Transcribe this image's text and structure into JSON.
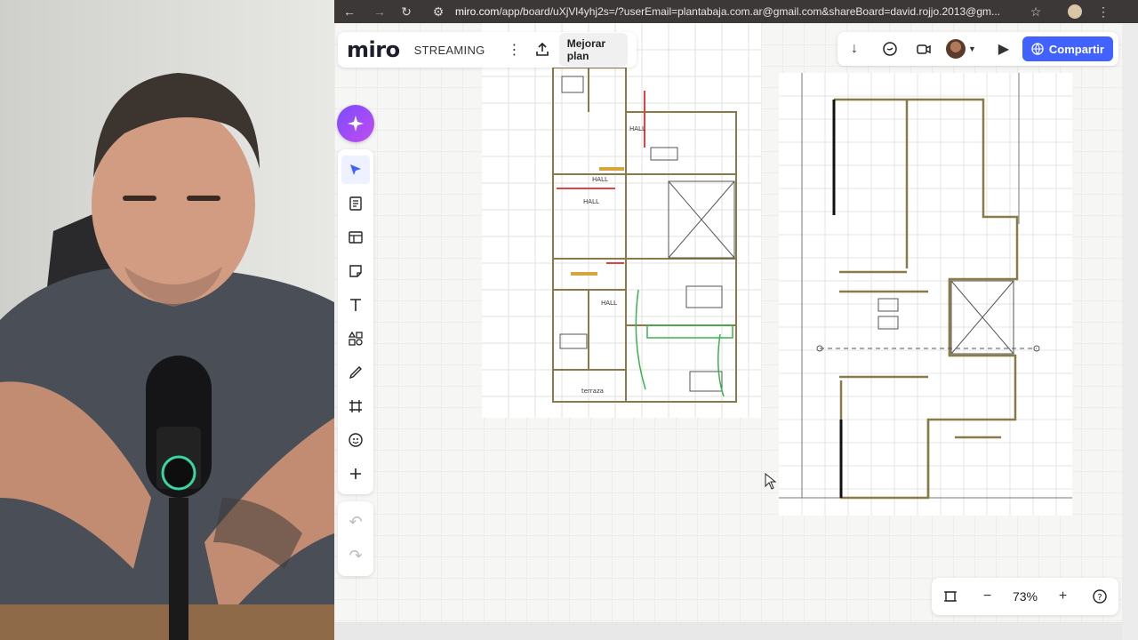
{
  "browser": {
    "url_host": "miro.com",
    "url_rest": "/app/board/uXjVl4yhj2s=/?userEmail=plantabaja.com.ar@gmail.com&shareBoard=david.rojjo.2013@gm..."
  },
  "header": {
    "logo": "miro",
    "board_name": "STREAMING",
    "upgrade_label": "Mejorar plan",
    "share_label": "Compartir"
  },
  "plan": {
    "labels": [
      "HALL",
      "HALL",
      "HALL",
      "HALL",
      "terraza"
    ]
  },
  "zoom": {
    "value": "73%"
  },
  "colors": {
    "accent": "#4262ff",
    "ai_gradient_start": "#7a4cff",
    "ai_gradient_end": "#c24cf0",
    "wall": "#8a7a4a"
  },
  "icons": {
    "toolbar": [
      "select-arrow-icon",
      "text-document-icon",
      "table-icon",
      "sticky-note-icon",
      "text-icon",
      "shapes-icon",
      "pen-icon",
      "frame-icon",
      "sticker-icon",
      "plus-icon"
    ],
    "history": [
      "undo-icon",
      "redo-icon"
    ]
  }
}
